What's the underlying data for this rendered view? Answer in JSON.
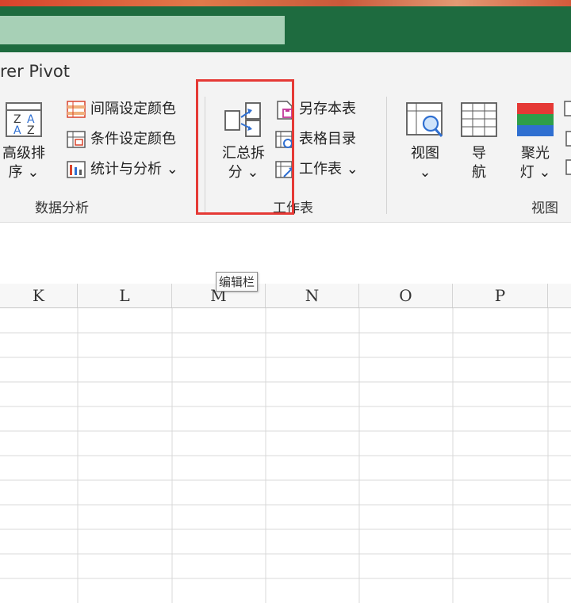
{
  "title_bar": {
    "accent_green": "#1e6b3f",
    "search_fill": "#a7d0b6"
  },
  "ribbon": {
    "tab_label": "rer Pivot",
    "groups": {
      "data_analysis": {
        "label": "数据分析",
        "advanced_sort": {
          "label_line1": "高级排",
          "label_line2": "序 ⌄",
          "icon": "sort-az-icon"
        },
        "items": [
          {
            "label": "间隔设定颜色",
            "icon": "alternate-color-icon"
          },
          {
            "label": "条件设定颜色",
            "icon": "conditional-color-icon"
          },
          {
            "label": "统计与分析 ⌄",
            "icon": "statistics-icon"
          }
        ]
      },
      "worksheet": {
        "label": "工作表",
        "merge_split": {
          "label_line1": "汇总拆",
          "label_line2": "分 ⌄",
          "icon": "merge-split-icon"
        },
        "items": [
          {
            "label": "另存本表",
            "icon": "save-sheet-icon"
          },
          {
            "label": "表格目录",
            "icon": "table-directory-icon"
          },
          {
            "label": "工作表 ⌄",
            "icon": "worksheet-icon"
          }
        ]
      },
      "view": {
        "label": "视图",
        "view_btn": {
          "label_line1": "视图",
          "label_line2": "⌄",
          "icon": "view-magnifier-icon"
        },
        "nav_btn": {
          "label_line1": "导",
          "label_line2": "航",
          "icon": "navigation-grid-icon"
        },
        "spotlight_btn": {
          "label_line1": "聚光",
          "label_line2": "灯 ⌄",
          "icon": "spotlight-icon"
        }
      }
    }
  },
  "tooltip": "编辑栏",
  "sheet": {
    "columns": [
      "K",
      "L",
      "M",
      "N",
      "O",
      "P"
    ]
  },
  "colors": {
    "highlight_border": "#e53935",
    "spotlight_red": "#e53935",
    "spotlight_green": "#2e9e4a",
    "spotlight_blue": "#2f6fd1"
  }
}
